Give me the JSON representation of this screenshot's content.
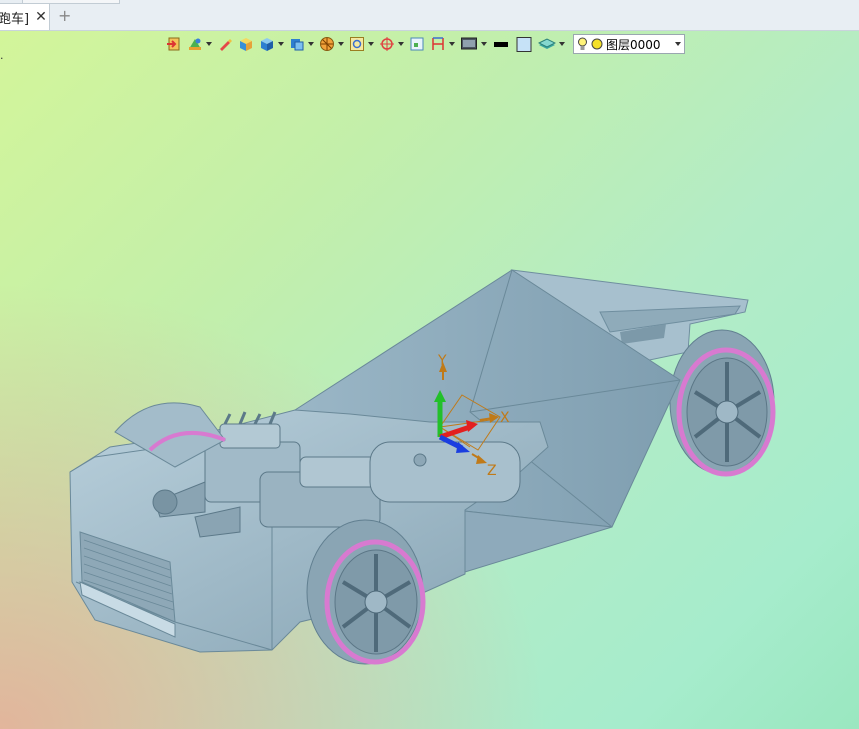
{
  "tab": {
    "label": "跑车]",
    "close": "✕",
    "add": "+"
  },
  "viewport": {
    "corner_text": "."
  },
  "toolbar": {
    "layer": {
      "name": "图层0000",
      "icons": [
        "lightbulb-icon",
        "yellow-circle-icon"
      ]
    },
    "buttons": [
      "import",
      "render-mode",
      "pen",
      "box",
      "solid",
      "view",
      "orient",
      "zoom",
      "snap",
      "frame",
      "dimension",
      "display",
      "color",
      "fill",
      "layer-stack"
    ]
  },
  "axes": {
    "x": "X",
    "y": "Y",
    "z": "Z"
  },
  "colors": {
    "model": "#9fb8c6",
    "tire_accent": "#d87ad0",
    "axis_x": "#e32020",
    "axis_y": "#22c02a",
    "axis_z": "#1a3ee0",
    "axis_label": "#c07a18"
  }
}
